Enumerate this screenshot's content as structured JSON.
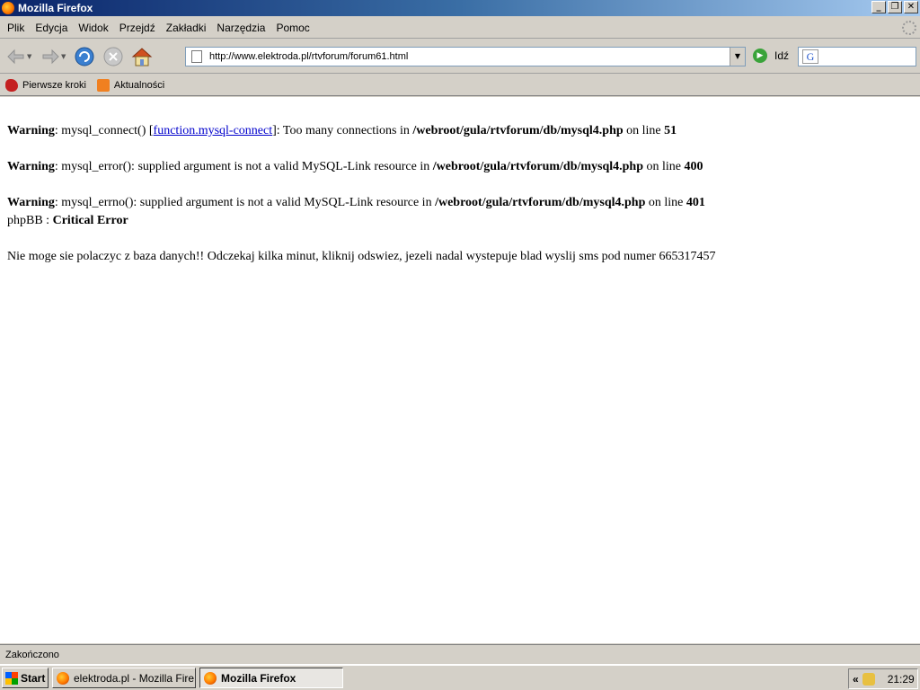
{
  "window": {
    "title": "Mozilla Firefox"
  },
  "menu": [
    "Plik",
    "Edycja",
    "Widok",
    "Przejdź",
    "Zakładki",
    "Narzędzia",
    "Pomoc"
  ],
  "navbar": {
    "url": "http://www.elektroda.pl/rtvforum/forum61.html",
    "go_label": "Idź"
  },
  "bookmarks": [
    {
      "label": "Pierwsze kroki",
      "icon": "firefox-bookmark-icon"
    },
    {
      "label": "Aktualności",
      "icon": "rss-icon"
    }
  ],
  "content": {
    "warning_label": "Warning",
    "w1": {
      "func": ": mysql_connect() [",
      "link": "function.mysql-connect",
      "rest": "]: Too many connections in ",
      "path": "/webroot/gula/rtvforum/db/mysql4.php",
      "online": " on line ",
      "line": "51"
    },
    "w2": {
      "func": ": mysql_error(): supplied argument is not a valid MySQL-Link resource in ",
      "path": "/webroot/gula/rtvforum/db/mysql4.php",
      "online": " on line ",
      "line": "400"
    },
    "w3": {
      "func": ": mysql_errno(): supplied argument is not a valid MySQL-Link resource in ",
      "path": "/webroot/gula/rtvforum/db/mysql4.php",
      "online": " on line ",
      "line": "401"
    },
    "phpbb_prefix": "phpBB : ",
    "critical": "Critical Error",
    "message": "Nie moge sie polaczyc z baza danych!! Odczekaj kilka minut, kliknij odswiez, jezeli nadal wystepuje blad wyslij sms pod numer 665317457"
  },
  "status": {
    "text": "Zakończono"
  },
  "taskbar": {
    "start": "Start",
    "tasks": [
      "elektroda.pl - Mozilla Fire...",
      "Mozilla Firefox"
    ],
    "tray_chevron": "«",
    "clock": "21:29"
  }
}
